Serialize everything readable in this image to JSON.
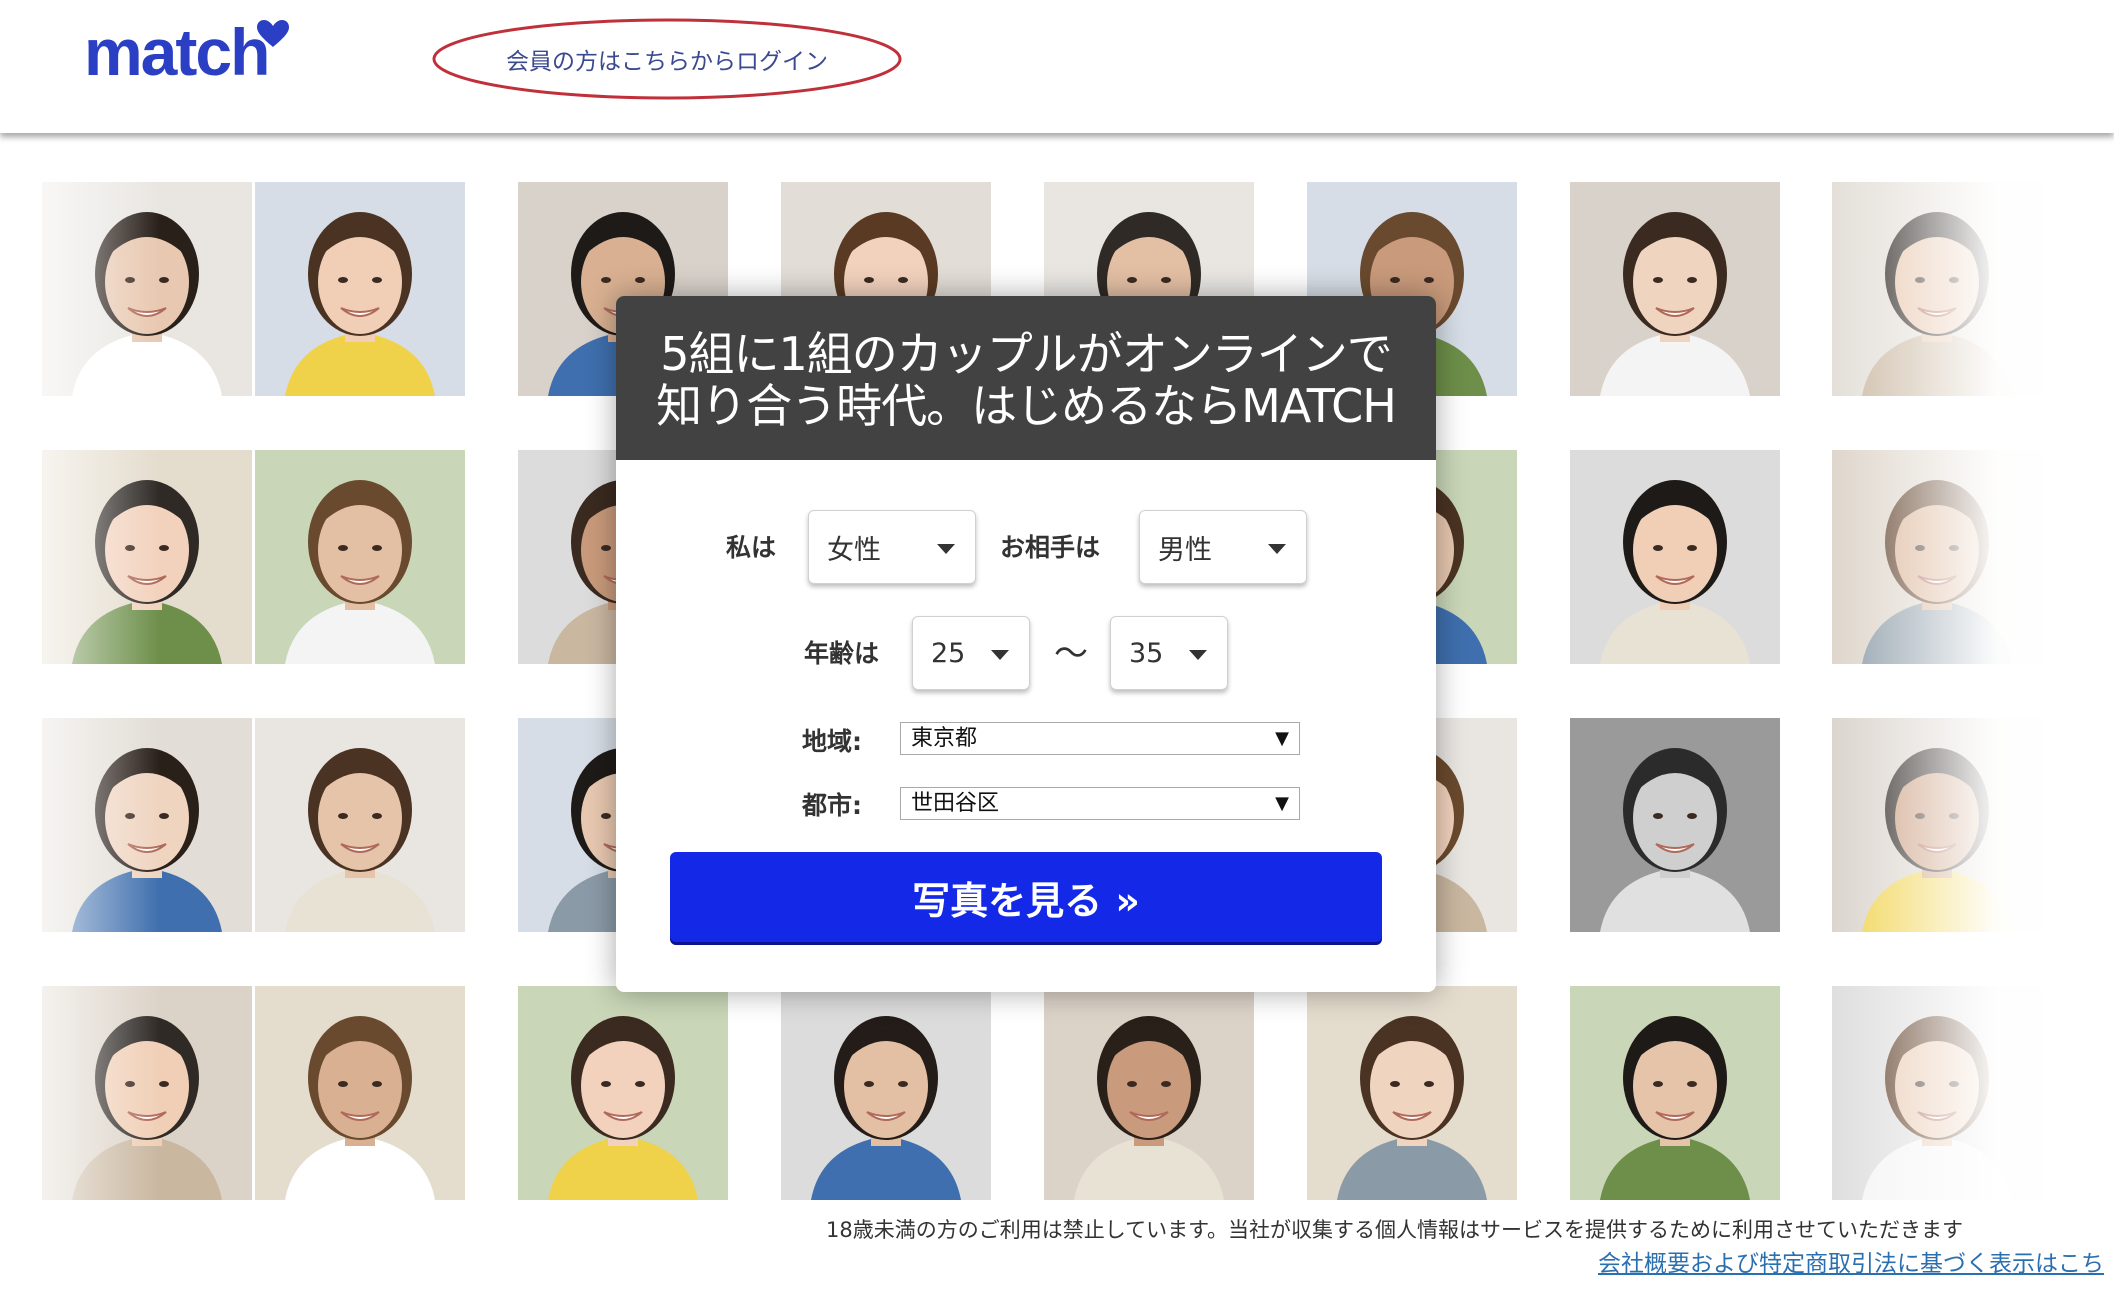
{
  "header": {
    "logo_text": "match",
    "login_link": "会員の方はこちらからログイン"
  },
  "panel": {
    "title": "5組に1組のカップルがオンラインで\n知り合う時代。はじめるならMATCH",
    "i_am_label": "私は",
    "i_am_value": "女性",
    "partner_label": "お相手は",
    "partner_value": "男性",
    "age_label": "年齢は",
    "age_min": "25",
    "age_separator": "〜",
    "age_max": "35",
    "region_label": "地域:",
    "region_value": "東京都",
    "city_label": "都市:",
    "city_value": "世田谷区",
    "cta_label": "写真を見る »"
  },
  "footer": {
    "note": "18歳未満の方のご利用は禁止しています。当社が収集する個人情報はサービスを提供するために利用させていただきます",
    "link": "会社概要および特定商取引法に基づく表示はこち"
  },
  "colors": {
    "brand": "#2b3fc4",
    "cta": "#1428e8",
    "panel_header": "#424242",
    "ellipse": "#c0303a"
  }
}
